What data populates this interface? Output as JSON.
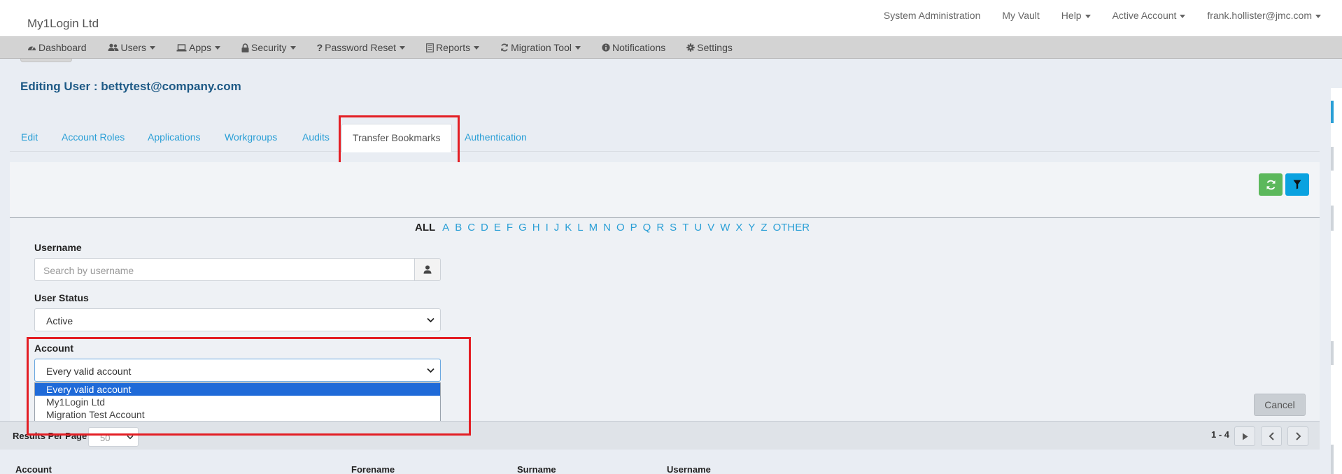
{
  "topbar": {
    "brand": "My1Login Ltd",
    "links": [
      {
        "label": "System Administration",
        "dropdown": false
      },
      {
        "label": "My Vault",
        "dropdown": false
      },
      {
        "label": "Help",
        "dropdown": true
      },
      {
        "label": "Active Account",
        "dropdown": true
      },
      {
        "label": "frank.hollister@jmc.com",
        "dropdown": true
      }
    ]
  },
  "mainnav": [
    {
      "label": "Dashboard",
      "icon": "dashboard-icon",
      "dropdown": false
    },
    {
      "label": "Users",
      "icon": "users-icon",
      "dropdown": true
    },
    {
      "label": "Apps",
      "icon": "laptop-icon",
      "dropdown": true
    },
    {
      "label": "Security",
      "icon": "lock-icon",
      "dropdown": true
    },
    {
      "label": "Password Reset",
      "icon": "question-icon",
      "dropdown": true
    },
    {
      "label": "Reports",
      "icon": "report-icon",
      "dropdown": true
    },
    {
      "label": "Migration Tool",
      "icon": "refresh-icon",
      "dropdown": true
    },
    {
      "label": "Notifications",
      "icon": "info-icon",
      "dropdown": false
    },
    {
      "label": "Settings",
      "icon": "gear-icon",
      "dropdown": false
    }
  ],
  "page": {
    "title": "Editing User : bettytest@company.com"
  },
  "tabs": [
    {
      "label": "Edit",
      "active": false
    },
    {
      "label": "Account Roles",
      "active": false
    },
    {
      "label": "Applications",
      "active": false
    },
    {
      "label": "Workgroups",
      "active": false
    },
    {
      "label": "Audits",
      "active": false
    },
    {
      "label": "Transfer Bookmarks",
      "active": true
    },
    {
      "label": "Authentication",
      "active": false
    }
  ],
  "alphabet": [
    "ALL",
    "A",
    "B",
    "C",
    "D",
    "E",
    "F",
    "G",
    "H",
    "I",
    "J",
    "K",
    "L",
    "M",
    "N",
    "O",
    "P",
    "Q",
    "R",
    "S",
    "T",
    "U",
    "V",
    "W",
    "X",
    "Y",
    "Z",
    "OTHER"
  ],
  "filters": {
    "username": {
      "label": "Username",
      "placeholder": "Search by username",
      "value": ""
    },
    "user_status": {
      "label": "User Status",
      "value": "Active"
    },
    "account": {
      "label": "Account",
      "value": "Every valid account",
      "options": [
        "Every valid account",
        "My1Login Ltd",
        "Migration Test Account"
      ],
      "highlighted_index": 0
    },
    "cancel_label": "Cancel"
  },
  "results": {
    "per_page_label": "Results Per Page",
    "per_page_value": "50",
    "range": "1 - 4"
  },
  "columns": [
    "Account",
    "Forename",
    "Surname",
    "Username"
  ],
  "colors": {
    "accent": "#2a9fd6",
    "title": "#1e5a86",
    "highlight": "#e31e24",
    "green": "#5cb85c",
    "blue": "#0aa2e0",
    "selected_option": "#1f6ad8"
  }
}
